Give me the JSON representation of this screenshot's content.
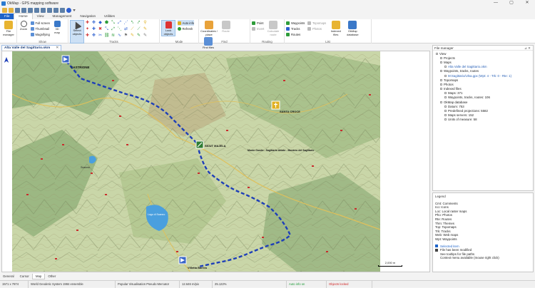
{
  "window": {
    "title": "OkMap - GPS mapping software",
    "buttons": [
      "—",
      "▢",
      "✕"
    ]
  },
  "menu_tabs": [
    {
      "label": "File",
      "kind": "file"
    },
    {
      "label": "Home",
      "kind": "active"
    },
    {
      "label": "View",
      "kind": ""
    },
    {
      "label": "Management",
      "kind": ""
    },
    {
      "label": "Navigation",
      "kind": ""
    },
    {
      "label": "Utilities",
      "kind": ""
    }
  ],
  "ribbon": {
    "file_manager": "File manager",
    "zoom": "Zoom",
    "full_screen": "Full screen",
    "thumbnail": "Thumbnail",
    "magnifying": "Magnifying",
    "map3d": "3D map",
    "show_group": "Show",
    "select_objects": "Select objects",
    "tracks_group": "Tracks",
    "lock_objects": "Lock objects",
    "auto_info": "Auto info",
    "refresh": "Refresh",
    "mode_group": "Mode",
    "coordinates_place": "Coordinates / place",
    "route": "Route",
    "find_files": "Find files",
    "find_group": "Find",
    "point": "Point",
    "invert": "Invert",
    "calculate_route": "Calculate route",
    "routing_group": "Routing",
    "waypoints": "Waypoints",
    "tracks": "Tracks",
    "routes": "Routes",
    "topmaps": "Topomaps",
    "photos": "Photos",
    "indexed_files": "Indexed files",
    "okmap_database": "OkMap database",
    "list_group": "List",
    "tool_colors": {
      "blue": "#2d5fd0",
      "green": "#2e9c3a",
      "yellow": "#e0b020",
      "red": "#d13b3b",
      "gray": "#7a7a7a"
    }
  },
  "document": {
    "tab_title": "Alta Valle del Sagittario.okm",
    "close": "✕"
  },
  "map": {
    "labels": {
      "top_left": "CASTRIONE",
      "ski": "SKIUT MAJELA",
      "mid": "Monte Gondo - Sagittario Ahiate - Montero del Sagittario",
      "yellow_pin": "SANTA CROCE",
      "bottom_pin": "Villetta Barrea",
      "lake": "Lago di Scanno",
      "town": "Scanno",
      "scale": "2,000 m"
    },
    "colors": {
      "terrain": "#c9d6a8",
      "forest": "#7ea46b",
      "track": "#1e3fb8",
      "road": "#e0c05a",
      "water": "#4a9fde",
      "contour": "#9a8a63"
    }
  },
  "file_manager": {
    "title": "File manager",
    "pin": "⊿ ✕",
    "tree": [
      {
        "label": "View",
        "indent": 0,
        "hl": false
      },
      {
        "label": "Projects",
        "indent": 1,
        "hl": false
      },
      {
        "label": "Maps",
        "indent": 1,
        "hl": false
      },
      {
        "label": "Alta Valle del Sagittario.okm",
        "indent": 2,
        "hl": true
      },
      {
        "label": "Waypoints, tracks, routes",
        "indent": 1,
        "hl": false
      },
      {
        "label": "M:Sagittario/Ulsa.gpx (Wpt: 4 - Trk: 0 - Rte: 1)",
        "indent": 2,
        "hl": true
      },
      {
        "label": "Topomaps",
        "indent": 1,
        "hl": false
      },
      {
        "label": "Photos",
        "indent": 1,
        "hl": false
      },
      {
        "label": "Indexed files",
        "indent": 1,
        "hl": false
      },
      {
        "label": "Maps: 371",
        "indent": 2,
        "hl": false
      },
      {
        "label": "Waypoints, tracks, routes: 106",
        "indent": 2,
        "hl": false
      },
      {
        "label": "OkMap database",
        "indent": 1,
        "hl": false
      },
      {
        "label": "Datum: 753",
        "indent": 2,
        "hl": false
      },
      {
        "label": "Predefined projections: 5582",
        "indent": 2,
        "hl": false
      },
      {
        "label": "Maps servers: 152",
        "indent": 2,
        "hl": false
      },
      {
        "label": "Units of measure: 58",
        "indent": 2,
        "hl": false
      }
    ]
  },
  "legend": {
    "title": "Legend",
    "items": [
      "Cmt: Comments",
      "Ico: Icons",
      "Loc: Local raster maps",
      "Pho: Photos",
      "Rte: Routes",
      "Thm: Themes",
      "Top: Topomaps",
      "Trk: Tracks",
      "Web: Web maps",
      "Wpt: Waypoints"
    ],
    "notes": [
      {
        "label": "Selected item",
        "color": "#1d63c9"
      },
      {
        "label": "File has been modified",
        "color": "#444444"
      },
      {
        "label": "See tooltips for file paths",
        "color": ""
      },
      {
        "label": "Context menu available (mouse right click)",
        "color": ""
      }
    ]
  },
  "bottom_tabs": [
    {
      "label": "General",
      "active": false
    },
    {
      "label": "Cursor",
      "active": false
    },
    {
      "label": "Map",
      "active": true
    },
    {
      "label": "Other",
      "active": false
    }
  ],
  "status": {
    "coords": "1571 x 7874",
    "datum": "World Geodetic System 1984 ensemble",
    "projection": "Popular Visualisation Pseudo Mercator",
    "resolution": "12.646 m/pix",
    "zoom": "25.122%",
    "auto_info": "Auto info on",
    "objects": "Objects locked"
  }
}
